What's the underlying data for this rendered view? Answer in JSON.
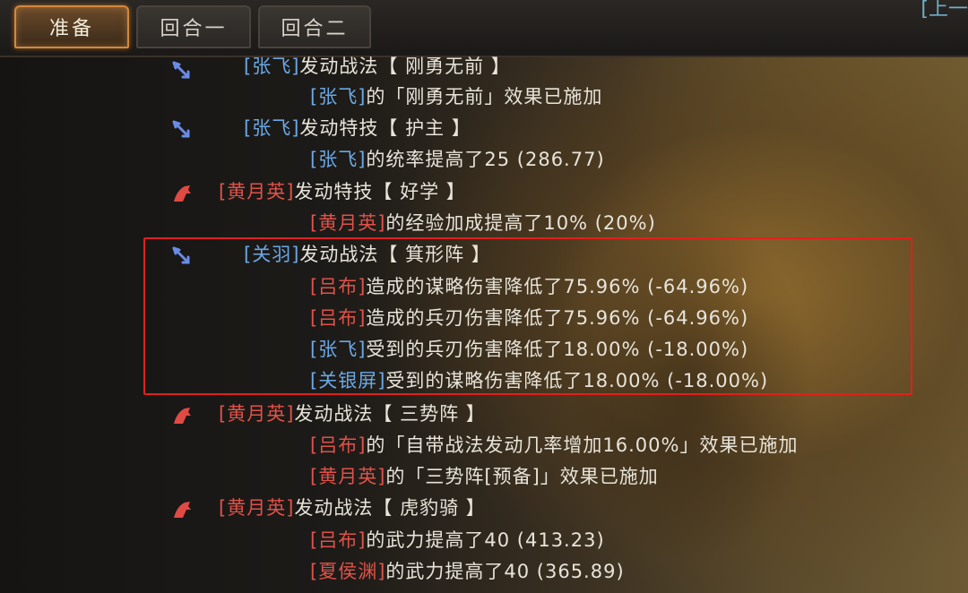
{
  "tabs": {
    "prep": "准备",
    "round1": "回合一",
    "round2": "回合二",
    "corner": "[上一"
  },
  "colors": {
    "ally": "#6aa8e6",
    "enemy": "#e0524a",
    "highlight": "#e0201c",
    "active_tab": "#d4883a"
  },
  "log": {
    "r0": {
      "icon": "blue-arrow-icon",
      "name": "[张飞]",
      "text": "发动战法【 刚勇无前 】"
    },
    "r1": {
      "name": "[张飞]",
      "text": "的「刚勇无前」效果已施加"
    },
    "r2": {
      "icon": "blue-arrow-icon",
      "name": "[张飞]",
      "text": "发动特技【 护主 】"
    },
    "r3": {
      "name": "[张飞]",
      "text": "的统率提高了25 (286.77)"
    },
    "r4": {
      "icon": "red-horse-icon",
      "name": "[黄月英]",
      "text": "发动特技【 好学 】"
    },
    "r5": {
      "name": "[黄月英]",
      "text": "的经验加成提高了10% (20%)"
    },
    "r6": {
      "icon": "blue-arrow-icon",
      "name": "[关羽]",
      "text": "发动战法【 箕形阵 】"
    },
    "r7": {
      "name": "[吕布]",
      "text": "造成的谋略伤害降低了75.96% (-64.96%)"
    },
    "r8": {
      "name": "[吕布]",
      "text": "造成的兵刃伤害降低了75.96% (-64.96%)"
    },
    "r9": {
      "name": "[张飞]",
      "text": "受到的兵刃伤害降低了18.00% (-18.00%)"
    },
    "r10": {
      "name": "[关银屏]",
      "text": "受到的谋略伤害降低了18.00% (-18.00%)"
    },
    "r11": {
      "icon": "red-horse-icon",
      "name": "[黄月英]",
      "text": "发动战法【 三势阵 】"
    },
    "r12": {
      "name": "[吕布]",
      "text": "的「自带战法发动几率增加16.00%」效果已施加"
    },
    "r13": {
      "name": "[黄月英]",
      "text": "的「三势阵[预备]」效果已施加"
    },
    "r14": {
      "icon": "red-horse-icon",
      "name": "[黄月英]",
      "text": "发动战法【 虎豹骑 】"
    },
    "r15": {
      "name": "[吕布]",
      "text": "的武力提高了40 (413.23)"
    },
    "r16": {
      "name": "[夏侯渊]",
      "text": "的武力提高了40 (365.89)"
    }
  }
}
